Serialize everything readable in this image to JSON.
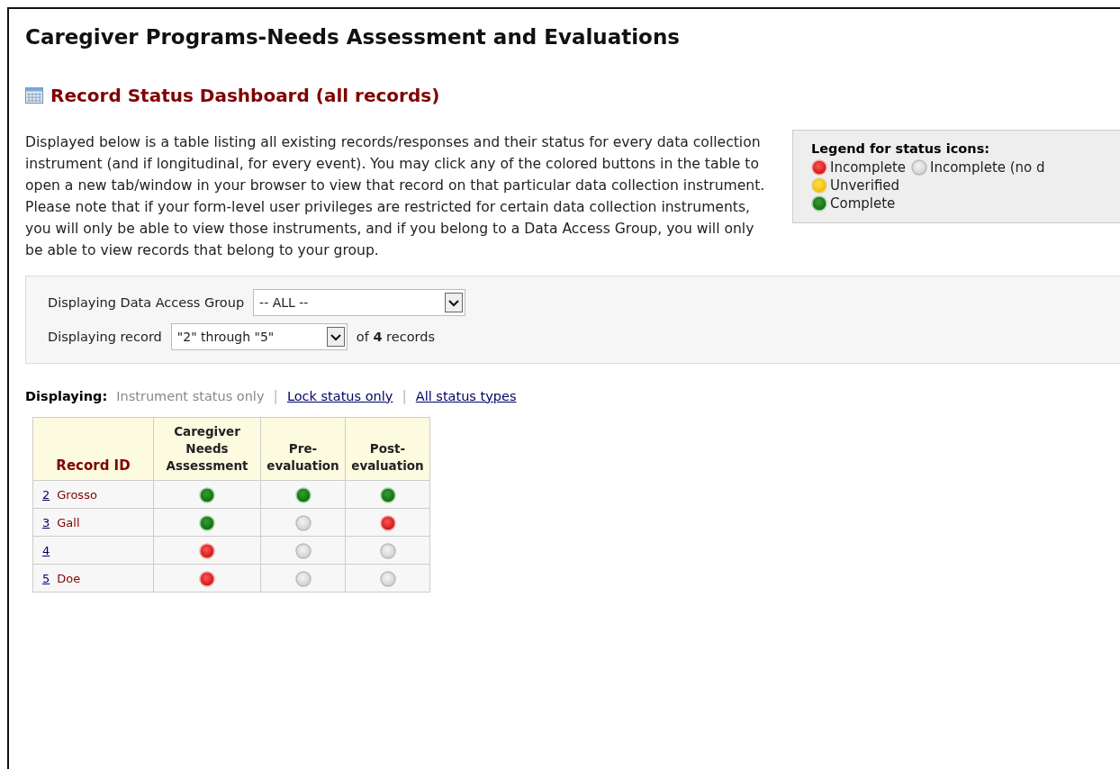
{
  "page_title": "Caregiver Programs-Needs Assessment and Evaluations",
  "dashboard_title": "Record Status Dashboard (all records)",
  "description": "Displayed below is a table listing all existing records/responses and their status for every data collection instrument (and if longitudinal, for every event). You may click any of the colored buttons in the table to open a new tab/window in your browser to view that record on that particular data collection instrument. Please note that if your form-level user privileges are restricted for certain data collection instruments, you will only be able to view those instruments, and if you belong to a Data Access Group, you will only be able to view records that belong to your group.",
  "legend": {
    "title": "Legend for status icons:",
    "lines": [
      [
        {
          "kind": "incomplete",
          "label": "Incomplete"
        },
        {
          "kind": "nodata",
          "label": "Incomplete (no d"
        }
      ],
      [
        {
          "kind": "unverified",
          "label": "Unverified"
        }
      ],
      [
        {
          "kind": "complete",
          "label": "Complete"
        }
      ]
    ]
  },
  "filters": {
    "group_label": "Displaying Data Access Group",
    "group_value": "-- ALL --",
    "record_label": "Displaying record",
    "record_value": "\"2\" through \"5\"",
    "record_count": "of **4** records"
  },
  "display_modes": {
    "label": "Displaying:",
    "separators": [
      "|",
      "|"
    ],
    "options": [
      {
        "label": "Instrument status only",
        "selected": true
      },
      {
        "label": "Lock status only",
        "selected": false
      },
      {
        "label": "All status types",
        "selected": false
      }
    ]
  },
  "table": {
    "columns": [
      "Record ID",
      "Caregiver Needs Assessment",
      "Pre-evaluation",
      "Post-evaluation"
    ],
    "rows": [
      {
        "id": "2",
        "name": "Grosso",
        "statuses": [
          {
            "kind": "complete"
          },
          {
            "kind": "complete"
          },
          {
            "kind": "complete"
          }
        ]
      },
      {
        "id": "3",
        "name": "Gall",
        "statuses": [
          {
            "kind": "complete"
          },
          {
            "kind": "nodata"
          },
          {
            "kind": "incomplete"
          }
        ]
      },
      {
        "id": "4",
        "statuses": [
          {
            "kind": "incomplete"
          },
          {
            "kind": "nodata"
          },
          {
            "kind": "nodata"
          }
        ]
      },
      {
        "id": "5",
        "name": "Doe",
        "statuses": [
          {
            "kind": "incomplete"
          },
          {
            "kind": "nodata"
          },
          {
            "kind": "nodata"
          }
        ]
      }
    ]
  }
}
